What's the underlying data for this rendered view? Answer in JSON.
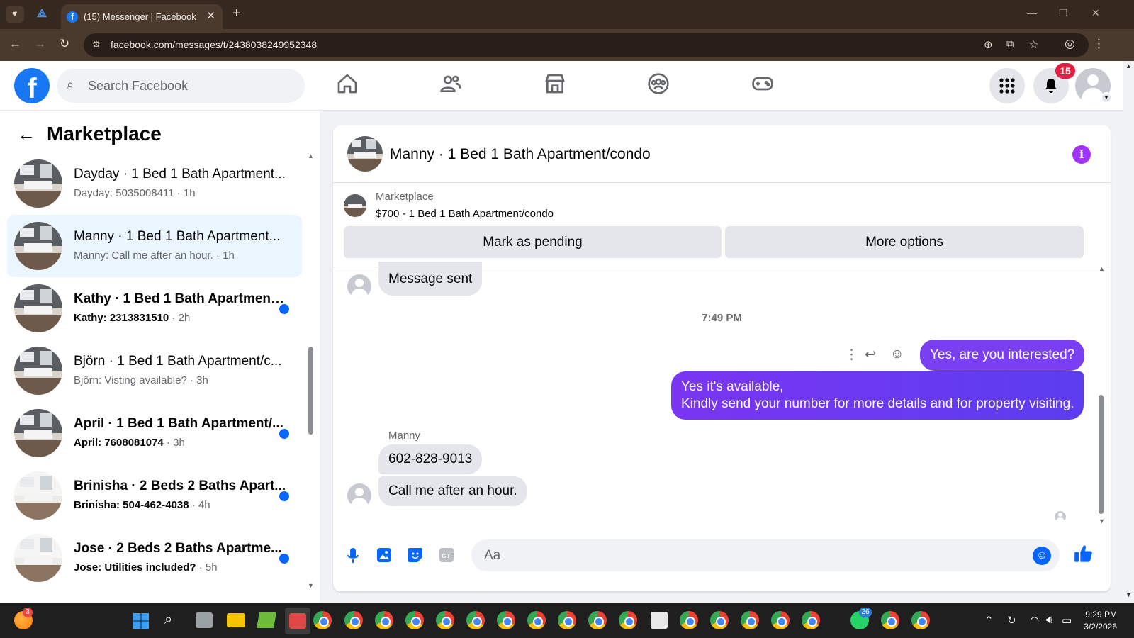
{
  "browser": {
    "tab_title": "(15) Messenger | Facebook",
    "url": "facebook.com/messages/t/2438038249952348"
  },
  "topbar": {
    "search_placeholder": "Search Facebook",
    "notification_count": "15"
  },
  "sidebar": {
    "title": "Marketplace",
    "conversations": [
      {
        "name": "Dayday · 1 Bed 1 Bath Apartment...",
        "preview": "Dayday: 5035008411",
        "time": "1h",
        "unread": false,
        "active": false,
        "thumb": "dark"
      },
      {
        "name": "Manny · 1 Bed 1 Bath Apartment...",
        "preview": "Manny: Call me after an hour.",
        "time": "1h",
        "unread": false,
        "active": true,
        "thumb": "dark"
      },
      {
        "name": "Kathy · 1 Bed 1 Bath Apartment...",
        "preview": "Kathy: 2313831510",
        "time": "2h",
        "unread": true,
        "active": false,
        "thumb": "dark"
      },
      {
        "name": "Björn · 1 Bed 1 Bath Apartment/c...",
        "preview": "Björn: Visting available?",
        "time": "3h",
        "unread": false,
        "active": false,
        "thumb": "dark"
      },
      {
        "name": "April · 1 Bed 1 Bath Apartment/...",
        "preview": "April: 7608081074",
        "time": "3h",
        "unread": true,
        "active": false,
        "thumb": "dark"
      },
      {
        "name": "Brinisha · 2 Beds 2 Baths Apart...",
        "preview": "Brinisha: 504-462-4038",
        "time": "4h",
        "unread": true,
        "active": false,
        "thumb": "light"
      },
      {
        "name": "Jose · 2 Beds 2 Baths Apartme...",
        "preview": "Jose: Utilities included?",
        "time": "5h",
        "unread": true,
        "active": false,
        "thumb": "light"
      }
    ]
  },
  "chat": {
    "title": "Manny · 1 Bed 1 Bath Apartment/condo",
    "marketplace_label": "Marketplace",
    "listing": "$700 - 1 Bed 1 Bath Apartment/condo",
    "mark_pending_label": "Mark as pending",
    "more_options_label": "More options",
    "messages": {
      "prev_message": "Message sent",
      "timestamp": "7:49 PM",
      "out_1": "Yes, are you interested?",
      "out_2_line1": "Yes it's available,",
      "out_2_line2": "Kindly send your number for more details and for property visiting.",
      "sender_name": "Manny",
      "in_1": "602-828-9013",
      "in_2": "Call me after an hour."
    },
    "composer_placeholder": "Aa"
  },
  "taskbar": {
    "firefox_badge": "3",
    "whatsapp_badge": "26",
    "time": "9:29 PM",
    "date": "3/2/2026"
  },
  "colors": {
    "facebook_blue": "#1877f2",
    "messenger_purple": "#7b3ff2",
    "unread_dot": "#0866ff",
    "notification_red": "#e41e3f"
  }
}
